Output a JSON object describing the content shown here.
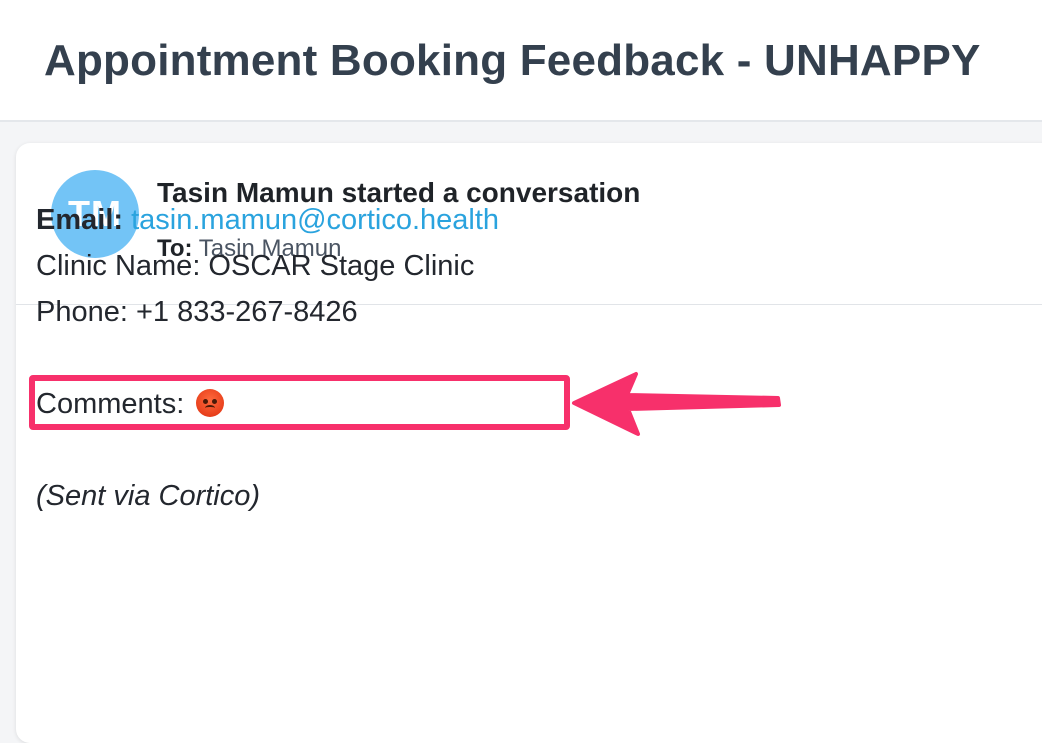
{
  "header": {
    "title": "Appointment Booking Feedback - UNHAPPY"
  },
  "conversation": {
    "avatar_initials": "TM",
    "avatar_color": "#73c4f6",
    "starter_text": "Tasin Mamun started a conversation",
    "to_label": "To:",
    "to_value": "Tasin Mamun"
  },
  "message": {
    "email_label": "Email:",
    "email_value": "tasin.mamun@cortico.health",
    "clinic_line": "Clinic Name: OSCAR Stage Clinic",
    "phone_line": "Phone: +1 833-267-8426",
    "comments_label": "Comments:",
    "comments_emoji": "angry-face-emoji",
    "sent_via": "(Sent via Cortico)"
  },
  "annotation": {
    "highlight_color": "#f7306b",
    "arrow_icon": "left-arrow-icon"
  }
}
